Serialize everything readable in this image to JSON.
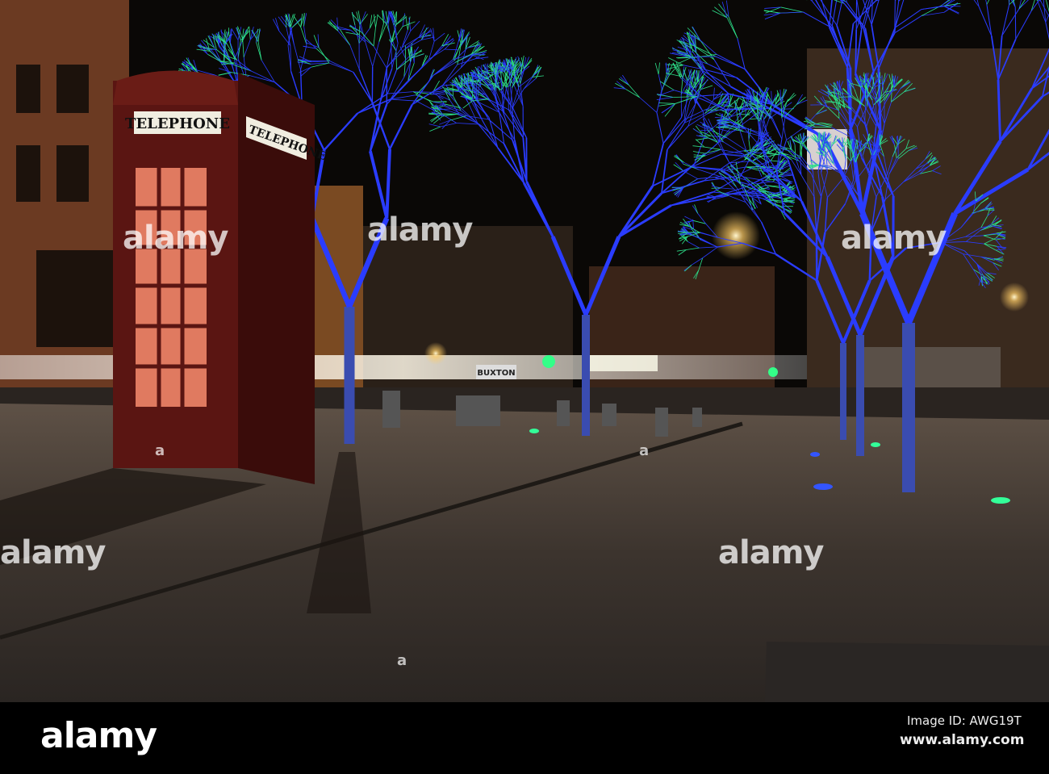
{
  "photo": {
    "phone_box_sign_front": "TELEPHONE",
    "phone_box_sign_side": "TELEPHONE",
    "shop_sign": "BUXTON",
    "watermark": "alamy",
    "watermark_mark": "a"
  },
  "footer": {
    "logo": "alamy",
    "image_id": "Image ID: AWG19T",
    "url": "www.alamy.com"
  },
  "colors": {
    "tree_blue": "#2a3cff",
    "tree_green": "#2de08a",
    "phone_box": "#5a1512",
    "pavement": "#4a4038"
  }
}
